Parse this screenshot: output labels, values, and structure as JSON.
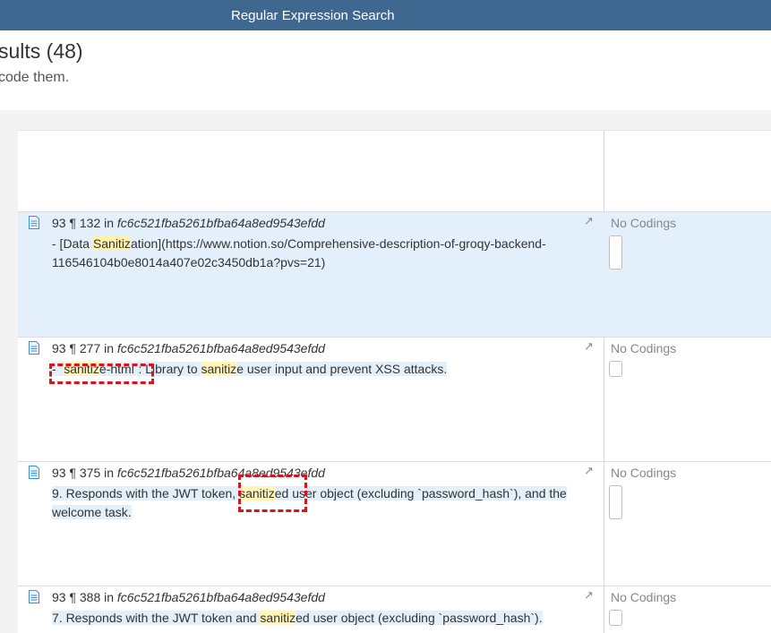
{
  "window": {
    "title": "Regular Expression Search"
  },
  "page": {
    "heading": "sults (48)",
    "subheading": "code them."
  },
  "results": [
    {
      "location": "93 ¶ 132 in ",
      "doc_id": "fc6c521fba5261bfba64a8ed9543efdd",
      "snippet": [
        {
          "t": "- [Data "
        },
        {
          "t": "Sanitiz",
          "hl": true
        },
        {
          "t": "ation](https://www.notion.so/Comprehensive-description-of-groqy-backend-116546104b0e8014a407e02c3450db1a?pvs=21)"
        }
      ],
      "codings": "No Codings",
      "selected": true
    },
    {
      "location": "93 ¶ 277 in ",
      "doc_id": "fc6c521fba5261bfba64a8ed9543efdd",
      "snippet": [
        {
          "t": "- `"
        },
        {
          "t": "sanitiz",
          "hl": true
        },
        {
          "t": "e-html`: Library to "
        },
        {
          "t": "sanitiz",
          "hl": true
        },
        {
          "t": "e user input and prevent XSS attacks."
        }
      ],
      "codings": "No Codings",
      "selected": false
    },
    {
      "location": "93 ¶ 375 in ",
      "doc_id": "fc6c521fba5261bfba64a8ed9543efdd",
      "snippet": [
        {
          "t": "9. Responds with the JWT token, "
        },
        {
          "t": "sanitiz",
          "hl": true
        },
        {
          "t": "ed user object (excluding `password_hash`), and the welcome task."
        }
      ],
      "codings": "No Codings",
      "selected": false
    },
    {
      "location": "93 ¶ 388 in ",
      "doc_id": "fc6c521fba5261bfba64a8ed9543efdd",
      "snippet": [
        {
          "t": "7. Responds with the JWT token and "
        },
        {
          "t": "sanitiz",
          "hl": true
        },
        {
          "t": "ed user object (excluding `password_hash`)."
        }
      ],
      "codings": "No Codings",
      "selected": false
    }
  ],
  "colors": {
    "titlebar": "#3f6890",
    "highlight": "#fff5b8",
    "selected_row": "#e3f0fb",
    "annotation_marker": "#d9141e"
  },
  "icons": {
    "document": "document-icon",
    "expand": "expand-arrow-icon"
  }
}
